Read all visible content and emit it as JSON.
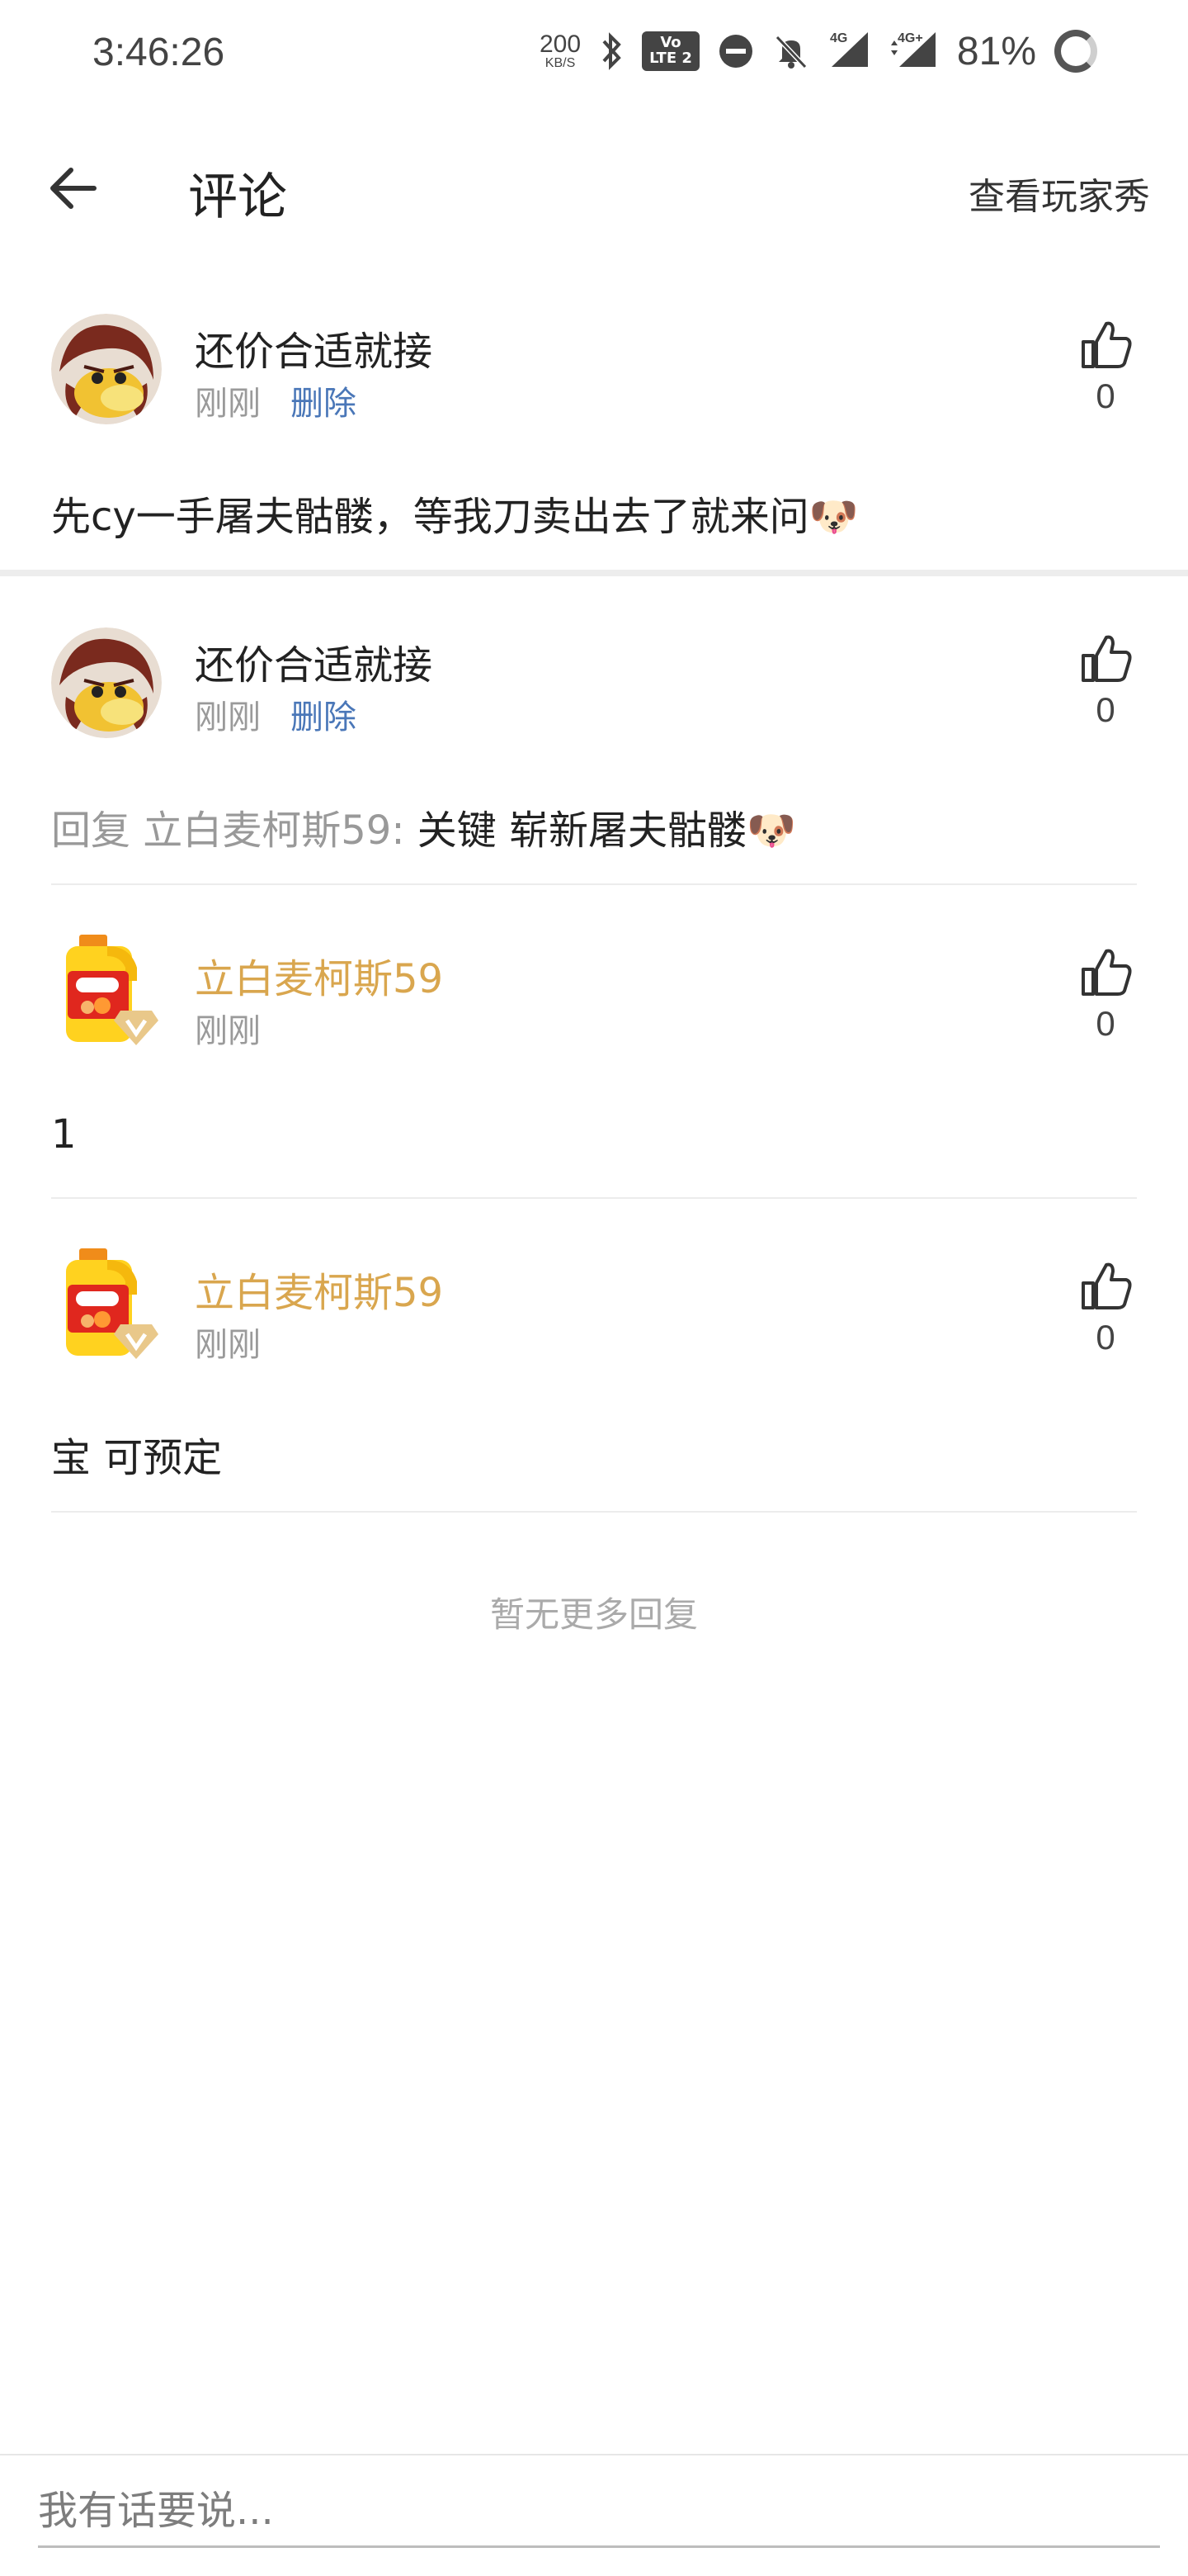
{
  "status_bar": {
    "time": "3:46:26",
    "speed_value": "200",
    "speed_unit": "KB/S",
    "volte_top": "Vo",
    "volte_bottom": "LTE 2",
    "network_1": "4G",
    "network_2": "4G+",
    "battery_text": "81%"
  },
  "appbar": {
    "title": "评论",
    "action_label": "查看玩家秀"
  },
  "comments": [
    {
      "username": "还价合适就接",
      "time": "刚刚",
      "delete_label": "删除",
      "likes": "0",
      "text": "先cy一手屠夫骷髅，等我刀卖出去了就来问🐶"
    },
    {
      "username": "还价合适就接",
      "time": "刚刚",
      "delete_label": "删除",
      "likes": "0",
      "reply_prefix": "回复 立白麦柯斯59:",
      "text": " 关键 崭新屠夫骷髅🐶"
    },
    {
      "username": "立白麦柯斯59",
      "time": "刚刚",
      "likes": "0",
      "text": "1"
    },
    {
      "username": "立白麦柯斯59",
      "time": "刚刚",
      "likes": "0",
      "text": "宝 可预定"
    }
  ],
  "no_more_text": "暂无更多回复",
  "reply_box": {
    "placeholder": "我有话要说..."
  },
  "colors": {
    "gold_username": "#d9a64e",
    "delete_link": "#4a77b8",
    "muted": "#9a9a9a"
  }
}
